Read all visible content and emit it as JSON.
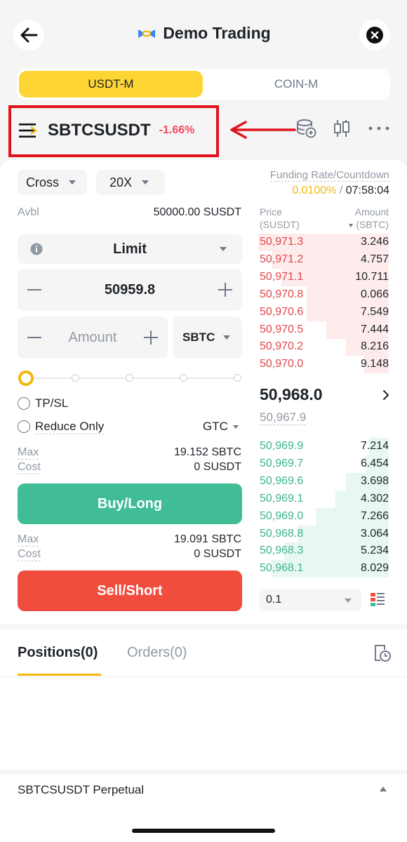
{
  "header": {
    "title": "Demo Trading",
    "back_icon": "arrow-left-icon",
    "close_icon": "close-circle-icon"
  },
  "market_tabs": [
    {
      "label": "USDT-M",
      "active": true
    },
    {
      "label": "COIN-M",
      "active": false
    }
  ],
  "symbol": {
    "name": "SBTCSUSDT",
    "change": "-1.66%"
  },
  "order_form": {
    "margin_mode": "Cross",
    "leverage": "20X",
    "avbl_label": "Avbl",
    "avbl_value": "50000.00 SUSDT",
    "order_type": "Limit",
    "price": "50959.8",
    "amount_placeholder": "Amount",
    "amount_unit": "SBTC",
    "slider_value": 0,
    "tpsl_label": "TP/SL",
    "reduce_only_label": "Reduce Only",
    "time_in_force": "GTC",
    "buy_max_label": "Max",
    "buy_max_value": "19.152 SBTC",
    "buy_cost_label": "Cost",
    "buy_cost_value": "0 SUSDT",
    "buy_label": "Buy/Long",
    "sell_max_label": "Max",
    "sell_max_value": "19.091 SBTC",
    "sell_cost_label": "Cost",
    "sell_cost_value": "0 SUSDT",
    "sell_label": "Sell/Short"
  },
  "funding": {
    "label": "Funding Rate/Countdown",
    "rate": "0.0100%",
    "separator": "/",
    "countdown": "07:58:04"
  },
  "orderbook": {
    "price_header": "Price",
    "price_unit": "(SUSDT)",
    "amount_header": "Amount",
    "amount_unit": "(SBTC)",
    "asks": [
      {
        "price": "50,971.3",
        "amount": "3.246",
        "depth": 1.0
      },
      {
        "price": "50,971.2",
        "amount": "4.757",
        "depth": 0.9
      },
      {
        "price": "50,971.1",
        "amount": "10.711",
        "depth": 0.82
      },
      {
        "price": "50,970.8",
        "amount": "0.066",
        "depth": 0.63
      },
      {
        "price": "50,970.6",
        "amount": "7.549",
        "depth": 0.63
      },
      {
        "price": "50,970.5",
        "amount": "7.444",
        "depth": 0.48
      },
      {
        "price": "50,970.2",
        "amount": "8.216",
        "depth": 0.33
      },
      {
        "price": "50,970.0",
        "amount": "9.148",
        "depth": 0.19
      }
    ],
    "last_price": "50,968.0",
    "mark_price": "50,967.9",
    "bids": [
      {
        "price": "50,969.9",
        "amount": "7.214",
        "depth": 0.15
      },
      {
        "price": "50,969.7",
        "amount": "6.454",
        "depth": 0.18
      },
      {
        "price": "50,969.6",
        "amount": "3.698",
        "depth": 0.33
      },
      {
        "price": "50,969.1",
        "amount": "4.302",
        "depth": 0.41
      },
      {
        "price": "50,969.0",
        "amount": "7.266",
        "depth": 0.56
      },
      {
        "price": "50,968.8",
        "amount": "3.064",
        "depth": 0.7
      },
      {
        "price": "50,968.3",
        "amount": "5.234",
        "depth": 0.8
      },
      {
        "price": "50,968.1",
        "amount": "8.029",
        "depth": 0.9
      }
    ],
    "precision": "0.1"
  },
  "bottom_tabs": [
    {
      "label": "Positions(0)",
      "active": true
    },
    {
      "label": "Orders(0)",
      "active": false
    }
  ],
  "footer": {
    "label": "SBTCSUSDT Perpetual"
  },
  "colors": {
    "accent": "#fcd535",
    "buy": "#40bd97",
    "sell": "#f14d3e",
    "annotation_red": "#e0131c"
  }
}
